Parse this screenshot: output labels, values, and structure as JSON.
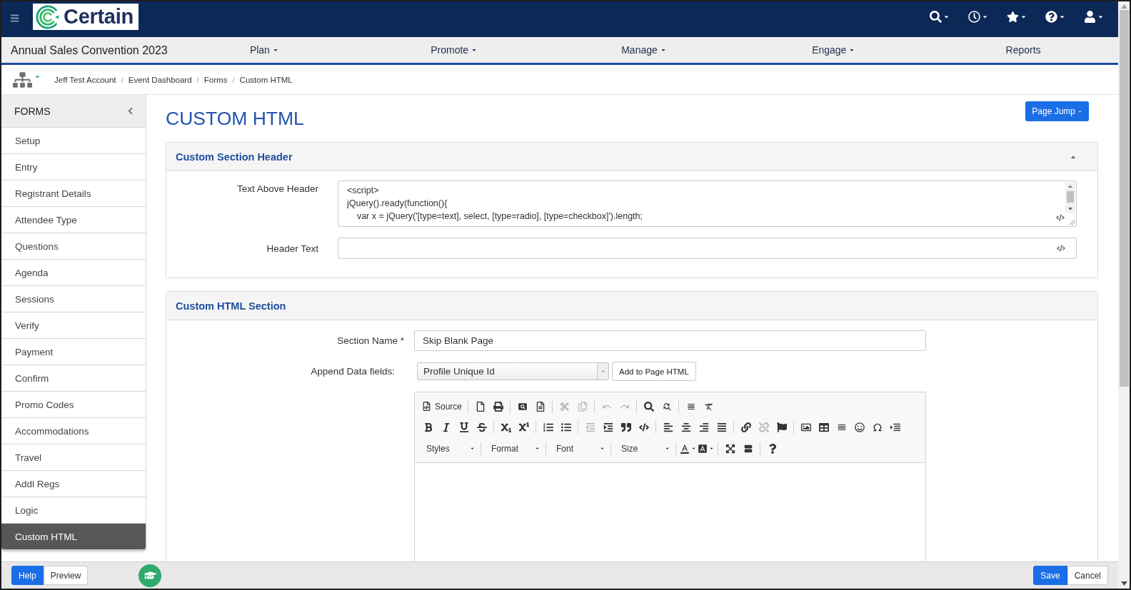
{
  "logo": {
    "text": "Certain"
  },
  "event_title": "Annual Sales Convention 2023",
  "nav_items": [
    {
      "label": "Plan",
      "dropdown": true
    },
    {
      "label": "Promote",
      "dropdown": true
    },
    {
      "label": "Manage",
      "dropdown": true
    },
    {
      "label": "Engage",
      "dropdown": true
    },
    {
      "label": "Reports",
      "dropdown": false
    }
  ],
  "breadcrumb": [
    {
      "label": "Jeff Test Account",
      "separator": "/"
    },
    {
      "label": "Event Dashboard",
      "separator": "/"
    },
    {
      "label": "Forms",
      "separator": "/"
    },
    {
      "label": "Custom HTML"
    }
  ],
  "sidebar": {
    "title": "FORMS",
    "items": [
      {
        "label": "Setup",
        "selected": false
      },
      {
        "label": "Entry",
        "selected": false
      },
      {
        "label": "Registrant Details",
        "selected": false
      },
      {
        "label": "Attendee Type",
        "selected": false
      },
      {
        "label": "Questions",
        "selected": false
      },
      {
        "label": "Agenda",
        "selected": false
      },
      {
        "label": "Sessions",
        "selected": false
      },
      {
        "label": "Verify",
        "selected": false
      },
      {
        "label": "Payment",
        "selected": false
      },
      {
        "label": "Confirm",
        "selected": false
      },
      {
        "label": "Promo Codes",
        "selected": false
      },
      {
        "label": "Accommodations",
        "selected": false
      },
      {
        "label": "Travel",
        "selected": false
      },
      {
        "label": "Addl Regs",
        "selected": false
      },
      {
        "label": "Logic",
        "selected": false
      },
      {
        "label": "Custom HTML",
        "selected": true
      }
    ]
  },
  "page": {
    "title": "CUSTOM HTML",
    "page_jump": "Page Jump"
  },
  "header_panel": {
    "title": "Custom Section Header",
    "expanded": true,
    "text_above_header": {
      "label": "Text Above Header",
      "lines": [
        "<script>",
        "jQuery().ready(function(){",
        "    var x = jQuery('[type=text], select, [type=radio], [type=checkbox]').length;"
      ]
    },
    "header_text": {
      "label": "Header Text"
    }
  },
  "html_panel": {
    "title": "Custom HTML Section",
    "section_name": {
      "label": "Section Name *",
      "value": "Skip Blank Page"
    },
    "append_data": {
      "label": "Append Data fields:",
      "value": "Profile Unique Id",
      "button": "Add to Page HTML"
    },
    "toolbar": [
      [
        [
          {
            "kind": "source",
            "label": "Source",
            "disabled": false
          }
        ],
        [
          {
            "kind": "newpage",
            "disabled": false
          },
          {
            "kind": "print",
            "disabled": false
          }
        ],
        [
          {
            "kind": "preview",
            "disabled": false
          },
          {
            "kind": "templates",
            "disabled": false
          }
        ],
        [
          {
            "kind": "cut",
            "disabled": true
          },
          {
            "kind": "copy",
            "disabled": true
          }
        ],
        [
          {
            "kind": "undo",
            "disabled": true
          },
          {
            "kind": "redo",
            "disabled": true
          }
        ],
        [
          {
            "kind": "find",
            "disabled": false
          },
          {
            "kind": "replace",
            "disabled": false
          }
        ],
        [
          {
            "kind": "selectall",
            "disabled": false
          },
          {
            "kind": "removeformat",
            "disabled": false
          }
        ]
      ],
      [
        [
          {
            "kind": "bold",
            "disabled": false
          },
          {
            "kind": "italic",
            "disabled": false
          },
          {
            "kind": "underline",
            "disabled": false
          },
          {
            "kind": "strike",
            "disabled": false
          }
        ],
        [
          {
            "kind": "subscript",
            "disabled": false
          },
          {
            "kind": "superscript",
            "disabled": false
          }
        ],
        [
          {
            "kind": "numberedlist",
            "disabled": false
          },
          {
            "kind": "bulletedlist",
            "disabled": false
          }
        ],
        [
          {
            "kind": "outdent",
            "disabled": true
          },
          {
            "kind": "indent",
            "disabled": false
          },
          {
            "kind": "blockquote",
            "disabled": false
          },
          {
            "kind": "div",
            "disabled": false
          }
        ],
        [
          {
            "kind": "alignleft",
            "disabled": false
          },
          {
            "kind": "aligncenter",
            "disabled": false
          },
          {
            "kind": "alignright",
            "disabled": false
          },
          {
            "kind": "justify",
            "disabled": false
          }
        ],
        [
          {
            "kind": "link",
            "disabled": false
          },
          {
            "kind": "unlink",
            "disabled": true
          },
          {
            "kind": "anchor",
            "disabled": false
          }
        ],
        [
          {
            "kind": "image",
            "disabled": false
          },
          {
            "kind": "table",
            "disabled": false
          },
          {
            "kind": "hr",
            "disabled": false
          },
          {
            "kind": "smiley",
            "disabled": false
          },
          {
            "kind": "specialchar",
            "disabled": false
          },
          {
            "kind": "iframe",
            "disabled": false
          }
        ]
      ],
      [
        [
          {
            "kind": "combo",
            "label": "Styles",
            "disabled": false
          }
        ],
        [
          {
            "kind": "combo",
            "label": "Format",
            "disabled": false
          }
        ],
        [
          {
            "kind": "combo",
            "label": "Font",
            "disabled": false
          }
        ],
        [
          {
            "kind": "combo",
            "label": "Size",
            "disabled": false
          }
        ],
        [
          {
            "kind": "textcolor",
            "disabled": false
          },
          {
            "kind": "bgcolor",
            "disabled": false
          }
        ],
        [
          {
            "kind": "maximize",
            "disabled": false
          },
          {
            "kind": "showblocks",
            "disabled": false
          }
        ],
        [
          {
            "kind": "about",
            "disabled": false
          }
        ]
      ]
    ]
  },
  "footer": {
    "left_buttons": [
      {
        "label": "Help",
        "kind": "primary"
      },
      {
        "label": "Preview",
        "kind": "default"
      }
    ],
    "right_buttons": [
      {
        "label": "Save",
        "kind": "primary"
      },
      {
        "label": "Cancel",
        "kind": "default"
      }
    ]
  }
}
